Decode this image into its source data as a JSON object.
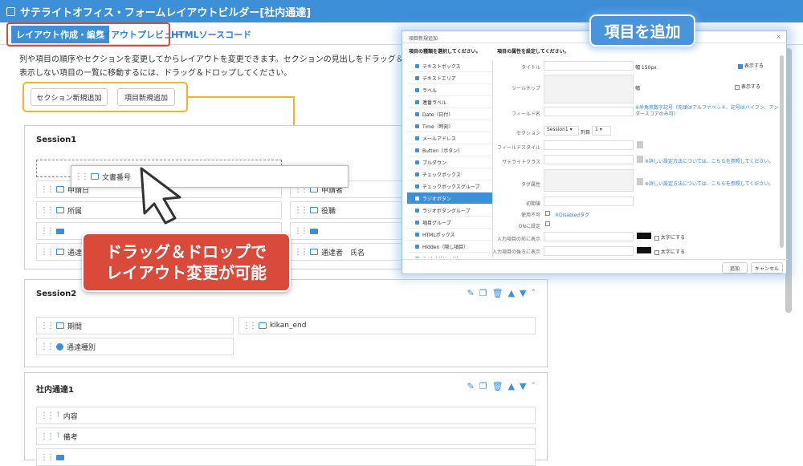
{
  "title": "サテライトオフィス・フォームレイアウトビルダー[社内通達]",
  "tabs": [
    "レイアウト作成・編集",
    "レイアウトプレビュー",
    "HTMLソースコード"
  ],
  "description": [
    "列や項目の順序やセクションを変更してからレイアウトを変更できます。セクションの見出しをドラッグ＆ドロップすると、",
    "表示しない項目の一覧に移動するには、ドラッグ＆ドロップしてください。"
  ],
  "buttons": {
    "add_section": "セクション新規追加",
    "add_item": "項目新規追加"
  },
  "sections": [
    {
      "title": "Session1",
      "fields": [
        "申請日",
        "申請者",
        "所属",
        "役職",
        "",
        "",
        "通達者",
        "通達者　氏名"
      ]
    },
    {
      "title": "Session2",
      "fields": [
        "期間",
        "kikan_end",
        "通達種別"
      ]
    },
    {
      "title": "社内通達1",
      "fields": [
        "内容",
        "備考",
        ""
      ]
    }
  ],
  "drag_item": "文書番号",
  "callouts": {
    "add_item": "項目を追加",
    "drag": "ドラッグ＆ドロップで\nレイアウト変更が可能"
  },
  "modal": {
    "title": "項目新規追加",
    "left_heading": "項目の種類を選択してください。",
    "right_heading": "項目の属性を設定してください。",
    "types": [
      "テキストボックス",
      "テキストエリア",
      "ラベル",
      "連番ラベル",
      "Date（日付）",
      "Time（時刻）",
      "メールアドレス",
      "Button（ボタン）",
      "プルダウン",
      "チェックボックス",
      "チェックボックスグループ",
      "ラジオボタン",
      "ラジオボタングループ",
      "項目グループ",
      "HTMLボックス",
      "Hidden（隠し項目）",
      "Grid（グリッド）"
    ],
    "selected_index": 11,
    "labels": {
      "title": "タイトル",
      "tooltip": "ツールチップ",
      "fieldname": "フィールド名",
      "section": "セクション",
      "fieldstyle": "フィールドスタイル",
      "satclass": "サテライトクラス",
      "tagattr": "タグ属性",
      "initial": "初期値",
      "disabled": "使用不可",
      "onclick": "ONに設定",
      "prefix": "入力項目の前に表示",
      "suffix": "入力項目の後ろに表示"
    },
    "values": {
      "width": "幅 150px",
      "width2": "幅",
      "show": "表示する",
      "section_sel": "Session1",
      "col_label": "列目",
      "col_sel": "1",
      "bold": "太字にする",
      "disabled_tag": "※Disabledタグ"
    },
    "notes": {
      "fieldname": "※半角英数字記号（先頭はアルファベット、記号はハイフン、アンダースコアのみ可）",
      "class": "※詳しい設定方法については、こちらを参照してください。",
      "tag": "※詳しい設定方法については、こちらを参照してください。"
    },
    "buttons": {
      "add": "追加",
      "cancel": "キャンセル"
    }
  },
  "colors": {
    "accent": "#3d8fd8",
    "highlight_red": "#d94a3b",
    "highlight_orange": "#f0b429"
  }
}
